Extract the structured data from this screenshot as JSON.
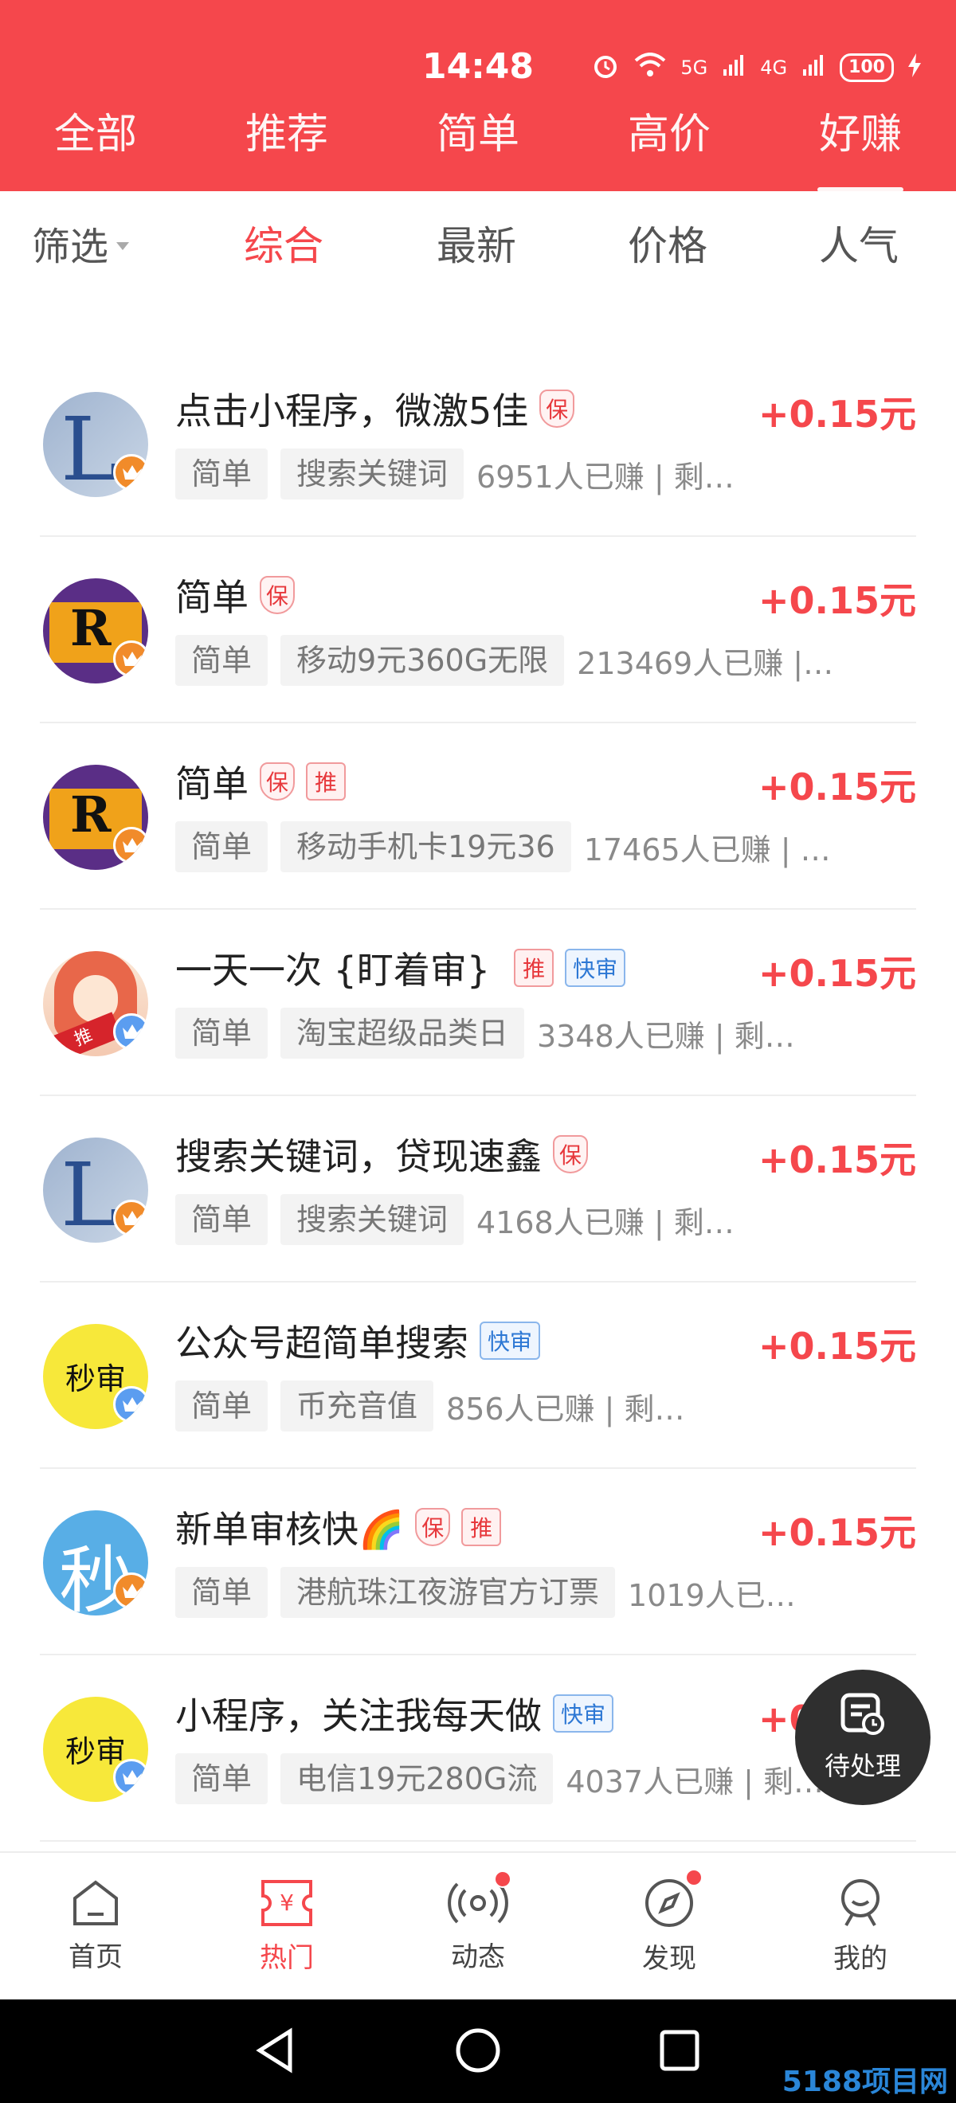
{
  "status_bar": {
    "time": "14:48",
    "battery": "100",
    "signal_1": "5G",
    "signal_2": "4G"
  },
  "top_tabs": [
    {
      "label": "全部"
    },
    {
      "label": "推荐"
    },
    {
      "label": "简单"
    },
    {
      "label": "高价"
    },
    {
      "label": "好赚",
      "active": true
    }
  ],
  "filter": {
    "label": "筛选",
    "sorts": [
      "综合",
      "最新",
      "价格",
      "人气"
    ],
    "active_sort": "综合"
  },
  "tasks": [
    {
      "title": "点击小程序，微激5佳",
      "tags": [
        "保"
      ],
      "price": "+0.15元",
      "category": "简单",
      "keyword": "搜索关键词",
      "meta": "6951人已赚 | 剩余数: …",
      "avatar": "L"
    },
    {
      "title": "简单",
      "tags": [
        "保"
      ],
      "price": "+0.15元",
      "category": "简单",
      "keyword": "移动9元360G无限",
      "meta": "213469人已赚 |…",
      "avatar": "R"
    },
    {
      "title": "简单",
      "tags": [
        "保",
        "推"
      ],
      "price": "+0.15元",
      "category": "简单",
      "keyword": "移动手机卡19元36",
      "meta": "17465人已赚 | …",
      "avatar": "R"
    },
    {
      "title": "一天一次 {盯着审}",
      "tags": [
        "推",
        "快审"
      ],
      "price": "+0.15元",
      "category": "简单",
      "keyword": "淘宝超级品类日",
      "meta": "3348人已赚 | 剩余…",
      "avatar": "推"
    },
    {
      "title": "搜索关键词，贷现速鑫",
      "tags": [
        "保"
      ],
      "price": "+0.15元",
      "category": "简单",
      "keyword": "搜索关键词",
      "meta": "4168人已赚 | 剩余数: …",
      "avatar": "L"
    },
    {
      "title": "公众号超简单搜索",
      "tags": [
        "快审"
      ],
      "price": "+0.15元",
      "category": "简单",
      "keyword": "币充音值",
      "meta": "856人已赚 | 剩余数: 1",
      "avatar": "秒审"
    },
    {
      "title": "新单审核快🌈",
      "tags": [
        "保",
        "推"
      ],
      "price": "+0.15元",
      "category": "简单",
      "keyword": "港航珠江夜游官方订票",
      "meta": "1019人已…",
      "avatar": "秒"
    },
    {
      "title": "小程序，关注我每天做",
      "tags": [
        "快审"
      ],
      "price": "+0.15元",
      "category": "简单",
      "keyword": "电信19元280G流",
      "meta": "4037人已赚 | 剩…",
      "avatar": "秒审"
    }
  ],
  "fab": {
    "label": "待处理"
  },
  "bottom_nav": [
    {
      "label": "首页",
      "icon": "home-icon"
    },
    {
      "label": "热门",
      "icon": "hot-ticket-icon",
      "active": true
    },
    {
      "label": "动态",
      "icon": "broadcast-icon",
      "badge": true
    },
    {
      "label": "发现",
      "icon": "compass-icon",
      "badge": true
    },
    {
      "label": "我的",
      "icon": "profile-icon"
    }
  ],
  "watermark": "5188项目网",
  "colors": {
    "primary": "#f5474c",
    "text": "#222222",
    "muted": "#8a8a8a"
  }
}
